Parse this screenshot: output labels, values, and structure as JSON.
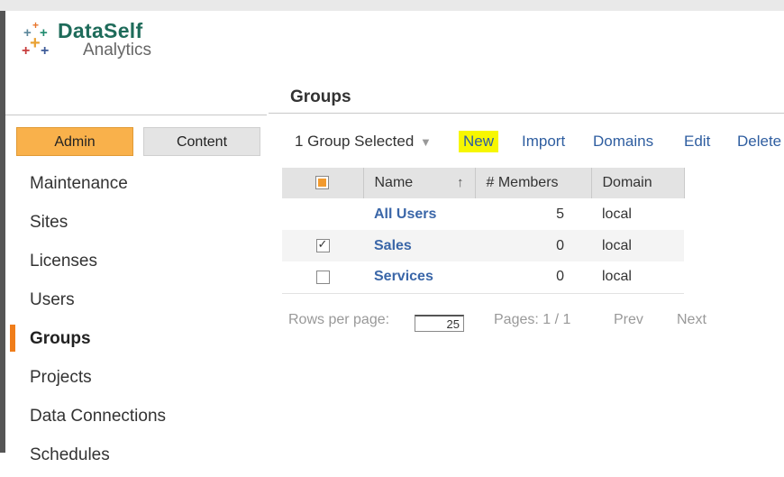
{
  "app": {
    "brand": "DataSelf",
    "sub": "Analytics",
    "colors": {
      "accent": "#f9b14b",
      "link": "#2f5ea0",
      "highlight": "#f7f700",
      "brand": "#1e6b5a"
    }
  },
  "header": {
    "title": "Groups"
  },
  "tabs": [
    {
      "label": "Admin",
      "active": true
    },
    {
      "label": "Content",
      "active": false
    }
  ],
  "sidebar": {
    "items": [
      {
        "label": "Maintenance"
      },
      {
        "label": "Sites"
      },
      {
        "label": "Licenses"
      },
      {
        "label": "Users"
      },
      {
        "label": "Groups",
        "active": true
      },
      {
        "label": "Projects"
      },
      {
        "label": "Data Connections"
      },
      {
        "label": "Schedules"
      }
    ]
  },
  "toolbar": {
    "selection": "1 Group Selected",
    "caret": "▼",
    "actions": [
      "New",
      "Import",
      "Domains",
      "Edit",
      "Delete"
    ]
  },
  "table": {
    "columns": [
      "Name",
      "# Members",
      "Domain"
    ],
    "sort_arrow": "↑",
    "rows": [
      {
        "name": "All Users",
        "members": "5",
        "domain": "local",
        "checkbox": "none"
      },
      {
        "name": "Sales",
        "members": "0",
        "domain": "local",
        "checkbox": "checked"
      },
      {
        "name": "Services",
        "members": "0",
        "domain": "local",
        "checkbox": "unchecked"
      }
    ]
  },
  "pager": {
    "rows_label": "Rows per page:",
    "rows_value": "25",
    "pages": "Pages: 1 / 1",
    "prev": "Prev",
    "next": "Next"
  }
}
